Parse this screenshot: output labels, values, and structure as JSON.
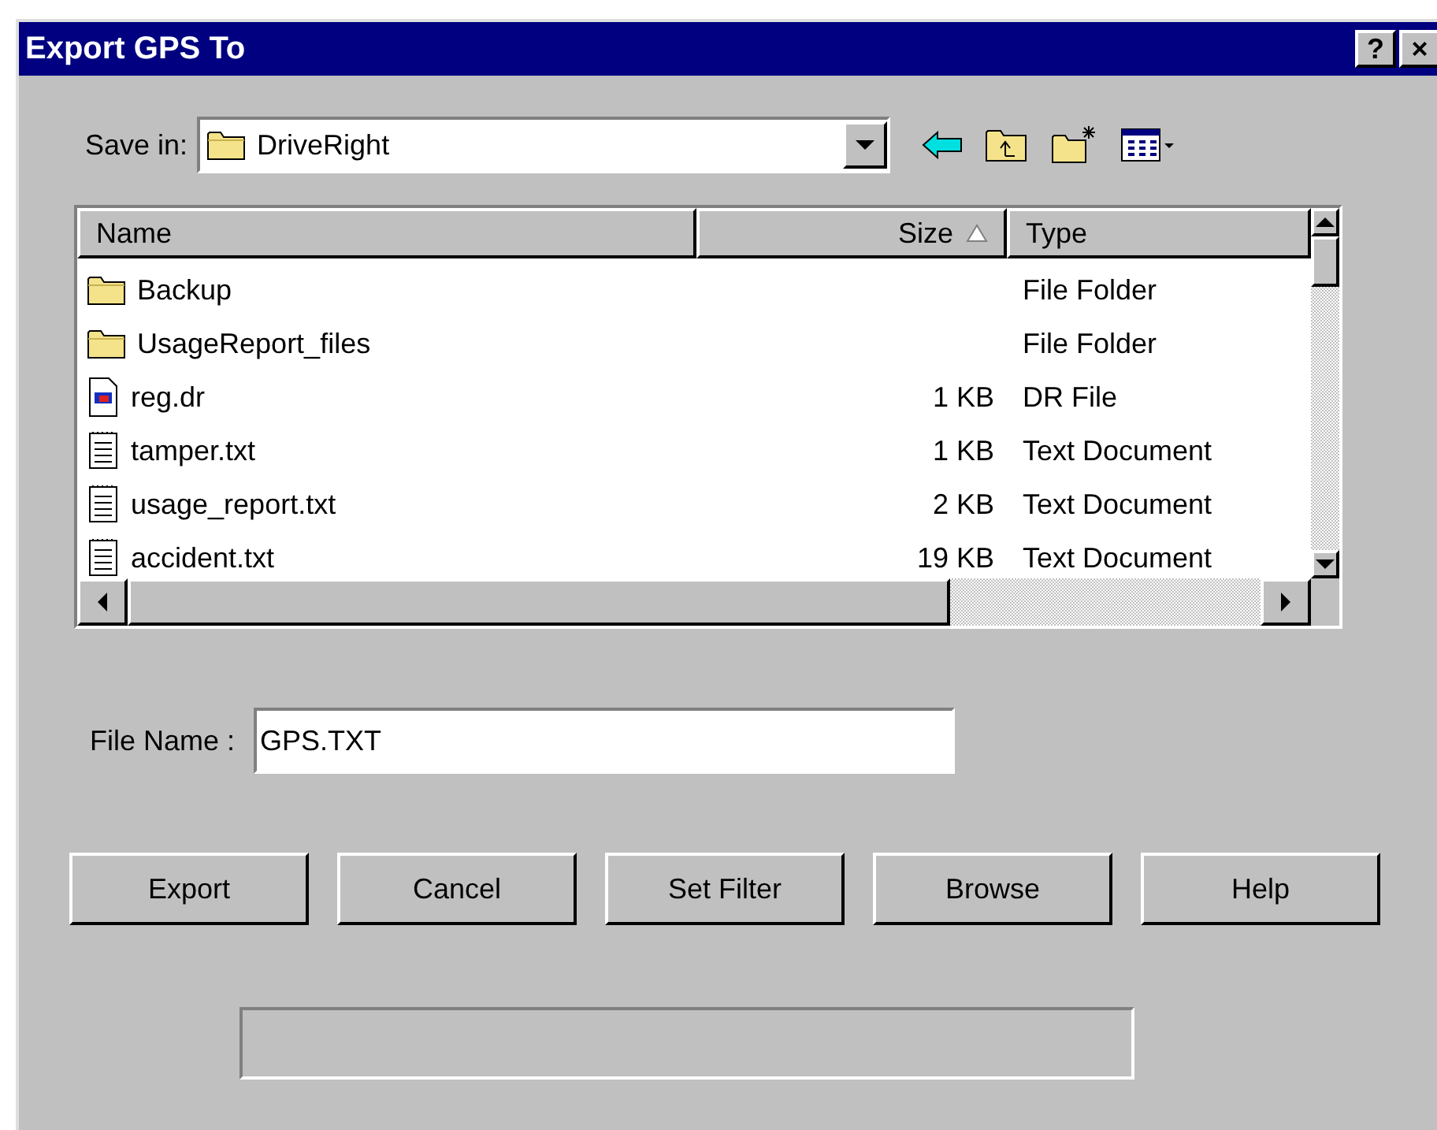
{
  "window": {
    "title": "Export GPS To",
    "title_buttons": [
      "?",
      "×"
    ]
  },
  "save_in": {
    "label": "Save in:",
    "value": "DriveRight"
  },
  "file_list": {
    "columns": [
      {
        "label": "Name",
        "sorted": false
      },
      {
        "label": "Size",
        "sorted": true
      },
      {
        "label": "Type",
        "sorted": false
      }
    ],
    "rows": [
      {
        "kind": "folder",
        "name": "Backup",
        "size": "",
        "type": "File Folder"
      },
      {
        "kind": "folder",
        "name": "UsageReport_files",
        "size": "",
        "type": "File Folder"
      },
      {
        "kind": "app",
        "name": "reg.dr",
        "size": "1 KB",
        "type": "DR File"
      },
      {
        "kind": "text",
        "name": "tamper.txt",
        "size": "1 KB",
        "type": "Text Document"
      },
      {
        "kind": "text",
        "name": "usage_report.txt",
        "size": "2 KB",
        "type": "Text Document"
      },
      {
        "kind": "text",
        "name": "accident.txt",
        "size": "19 KB",
        "type": "Text Document"
      }
    ]
  },
  "file_name": {
    "label": "File Name :",
    "value": "GPS.TXT"
  },
  "buttons": [
    "Export",
    "Cancel",
    "Set Filter",
    "Browse",
    "Help"
  ]
}
